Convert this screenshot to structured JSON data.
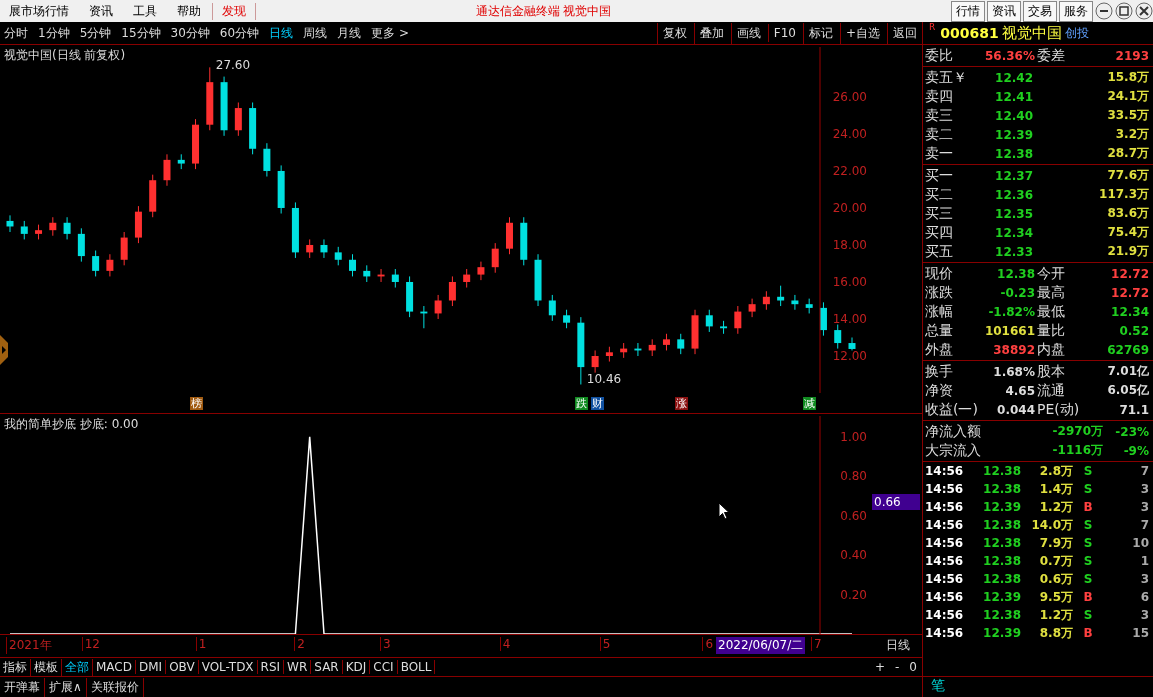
{
  "menu": {
    "items": [
      {
        "label": "展市场行情",
        "selected": false
      },
      {
        "label": "资讯",
        "selected": false
      },
      {
        "label": "工具",
        "selected": false
      },
      {
        "label": "帮助",
        "selected": false
      },
      {
        "label": "发现",
        "selected": true
      }
    ],
    "title": "通达信金融终端  视觉中国",
    "buttons": [
      "行情",
      "资讯",
      "交易",
      "服务"
    ]
  },
  "periods": [
    {
      "label": "分时",
      "selected": false
    },
    {
      "label": "1分钟",
      "selected": false
    },
    {
      "label": "5分钟",
      "selected": false
    },
    {
      "label": "15分钟",
      "selected": false
    },
    {
      "label": "30分钟",
      "selected": false
    },
    {
      "label": "60分钟",
      "selected": false
    },
    {
      "label": "日线",
      "selected": true
    },
    {
      "label": "周线",
      "selected": false
    },
    {
      "label": "月线",
      "selected": false
    },
    {
      "label": "更多 >",
      "selected": false
    }
  ],
  "tools": [
    "复权",
    "叠加",
    "画线",
    "F10",
    "标记",
    "+自选",
    "返回"
  ],
  "chart_title": "视觉中国(日线 前复权)",
  "price_chart": {
    "chart_data": {
      "type": "candlestick",
      "ylim": [
        10,
        28.7
      ],
      "yticks": [
        {
          "value": 12,
          "label": "12.00"
        },
        {
          "value": 14,
          "label": "14.00"
        },
        {
          "value": 16,
          "label": "16.00"
        },
        {
          "value": 18,
          "label": "18.00"
        },
        {
          "value": 20,
          "label": "20.00"
        },
        {
          "value": 22,
          "label": "22.00"
        },
        {
          "value": 24,
          "label": "24.00"
        },
        {
          "value": 26,
          "label": "26.00"
        }
      ],
      "categories": [
        null,
        null,
        null,
        null,
        null,
        null,
        null,
        null,
        null,
        null,
        null,
        null,
        null,
        null,
        null,
        null,
        null,
        null,
        null,
        null,
        null,
        null,
        null,
        null,
        null,
        null,
        null,
        null,
        null,
        null,
        null,
        null,
        null,
        null,
        null,
        null,
        null,
        null,
        null,
        null,
        null,
        null,
        null,
        null,
        null,
        null,
        null,
        null,
        null,
        null,
        null,
        null,
        null,
        null,
        null,
        null,
        null,
        null,
        null,
        null
      ],
      "ohlc": [
        [
          19.3,
          19.6,
          18.7,
          19.0
        ],
        [
          19.0,
          19.3,
          18.3,
          18.6
        ],
        [
          18.6,
          19.1,
          18.3,
          18.8
        ],
        [
          18.8,
          19.5,
          18.5,
          19.2
        ],
        [
          19.2,
          19.5,
          18.3,
          18.6
        ],
        [
          18.6,
          18.9,
          17.1,
          17.4
        ],
        [
          17.4,
          17.7,
          16.3,
          16.6
        ],
        [
          16.6,
          17.5,
          16.3,
          17.2
        ],
        [
          17.2,
          18.7,
          16.9,
          18.4
        ],
        [
          18.4,
          20.1,
          18.1,
          19.8
        ],
        [
          19.8,
          21.8,
          19.5,
          21.5
        ],
        [
          21.5,
          22.9,
          21.2,
          22.6
        ],
        [
          22.6,
          22.9,
          22.1,
          22.4
        ],
        [
          22.4,
          24.8,
          22.1,
          24.5
        ],
        [
          24.5,
          27.6,
          24.2,
          26.8
        ],
        [
          26.8,
          27.1,
          23.9,
          24.2
        ],
        [
          24.2,
          25.7,
          23.9,
          25.4
        ],
        [
          25.4,
          25.7,
          22.9,
          23.2
        ],
        [
          23.2,
          23.5,
          21.7,
          22.0
        ],
        [
          22.0,
          22.3,
          19.7,
          20.0
        ],
        [
          20.0,
          20.3,
          17.3,
          17.6
        ],
        [
          17.6,
          18.3,
          17.3,
          18.0
        ],
        [
          18.0,
          18.3,
          17.3,
          17.6
        ],
        [
          17.6,
          17.9,
          16.9,
          17.2
        ],
        [
          17.2,
          17.5,
          16.3,
          16.6
        ],
        [
          16.6,
          16.9,
          16.0,
          16.3
        ],
        [
          16.3,
          16.7,
          16.0,
          16.4
        ],
        [
          16.4,
          16.7,
          15.7,
          16.0
        ],
        [
          16.0,
          16.3,
          14.1,
          14.4
        ],
        [
          14.4,
          14.7,
          13.5,
          14.3
        ],
        [
          14.3,
          15.3,
          14.0,
          15.0
        ],
        [
          15.0,
          16.3,
          14.7,
          16.0
        ],
        [
          16.0,
          16.7,
          15.7,
          16.4
        ],
        [
          16.4,
          17.1,
          16.1,
          16.8
        ],
        [
          16.8,
          18.1,
          16.5,
          17.8
        ],
        [
          17.8,
          19.5,
          17.5,
          19.2
        ],
        [
          19.2,
          19.5,
          16.9,
          17.2
        ],
        [
          17.2,
          17.5,
          14.7,
          15.0
        ],
        [
          15.0,
          15.3,
          13.9,
          14.2
        ],
        [
          14.2,
          14.5,
          13.5,
          13.8
        ],
        [
          13.8,
          14.1,
          10.46,
          11.4
        ],
        [
          11.4,
          12.3,
          11.1,
          12.0
        ],
        [
          12.0,
          12.5,
          11.7,
          12.2
        ],
        [
          12.2,
          12.7,
          11.9,
          12.4
        ],
        [
          12.4,
          12.7,
          12.0,
          12.3
        ],
        [
          12.3,
          12.9,
          12.0,
          12.6
        ],
        [
          12.6,
          13.2,
          12.3,
          12.9
        ],
        [
          12.9,
          13.2,
          12.1,
          12.4
        ],
        [
          12.4,
          14.5,
          12.1,
          14.2
        ],
        [
          14.2,
          14.5,
          13.3,
          13.6
        ],
        [
          13.6,
          13.9,
          13.2,
          13.5
        ],
        [
          13.5,
          14.7,
          13.2,
          14.4
        ],
        [
          14.4,
          15.1,
          14.1,
          14.8
        ],
        [
          14.8,
          15.5,
          14.5,
          15.2
        ],
        [
          15.2,
          15.8,
          14.7,
          15.0
        ],
        [
          15.0,
          15.3,
          14.5,
          14.8
        ],
        [
          14.8,
          15.1,
          14.3,
          14.6
        ],
        [
          14.6,
          14.9,
          13.1,
          13.4
        ],
        [
          13.4,
          13.7,
          12.4,
          12.7
        ],
        [
          12.7,
          13.0,
          12.3,
          12.38
        ]
      ],
      "annotations": [
        "27.60",
        "10.46"
      ]
    },
    "markers": [
      {
        "label": "榜",
        "color": "#a05a10"
      },
      {
        "label": "跌",
        "color": "#108a20"
      },
      {
        "label": "财",
        "color": "#1050a0"
      },
      {
        "label": "涨",
        "color": "#8a1010"
      },
      {
        "label": "减",
        "color": "#108a20"
      }
    ]
  },
  "indicator": {
    "title": "我的简单抄底 抄底: 0.00",
    "cursor_value": "0.66",
    "chart_data": {
      "type": "line",
      "ylim": [
        0,
        1.106
      ],
      "yticks": [
        {
          "value": 0.2,
          "label": "0.20"
        },
        {
          "value": 0.4,
          "label": "0.40"
        },
        {
          "value": 0.6,
          "label": "0.60"
        },
        {
          "value": 0.8,
          "label": "0.80"
        },
        {
          "value": 1.0,
          "label": "1.00"
        }
      ],
      "categories": [
        null,
        null,
        null,
        null,
        null,
        null,
        null,
        null,
        null,
        null,
        null,
        null,
        null,
        null,
        null,
        null,
        null,
        null,
        null,
        null,
        null,
        null,
        null,
        null,
        null,
        null,
        null,
        null,
        null,
        null,
        null,
        null,
        null,
        null,
        null,
        null,
        null,
        null,
        null,
        null,
        null,
        null,
        null,
        null,
        null,
        null,
        null,
        null,
        null,
        null,
        null,
        null,
        null,
        null,
        null,
        null,
        null,
        null,
        null,
        null
      ],
      "values": [
        0,
        0,
        0,
        0,
        0,
        0,
        0,
        0,
        0,
        0,
        0,
        0,
        0,
        0,
        0,
        0,
        0,
        0,
        0,
        0,
        0,
        1,
        0,
        0,
        0,
        0,
        0,
        0,
        0,
        0,
        0,
        0,
        0,
        0,
        0,
        0,
        0,
        0,
        0,
        0,
        0,
        0,
        0,
        0,
        0,
        0,
        0,
        0,
        0,
        0,
        0,
        0,
        0,
        0,
        0,
        0,
        0,
        0,
        0,
        0
      ]
    }
  },
  "date_labels": [
    "2021年",
    "12",
    "1",
    "2",
    "3",
    "4",
    "5",
    "6",
    "7"
  ],
  "date_cursor": "2022/06/07/二",
  "period_label": "日线",
  "indicator_tabs": [
    {
      "label": "指标",
      "selected": false
    },
    {
      "label": "模板",
      "selected": false
    },
    {
      "label": "全部",
      "selected": true
    },
    {
      "label": "MACD",
      "selected": false
    },
    {
      "label": "DMI",
      "selected": false
    },
    {
      "label": "OBV",
      "selected": false
    },
    {
      "label": "VOL-TDX",
      "selected": false
    },
    {
      "label": "RSI",
      "selected": false
    },
    {
      "label": "WR",
      "selected": false
    },
    {
      "label": "SAR",
      "selected": false
    },
    {
      "label": "KDJ",
      "selected": false
    },
    {
      "label": "CCI",
      "selected": false
    },
    {
      "label": "BOLL",
      "selected": false
    }
  ],
  "zoom_buttons": [
    "+",
    "-",
    "0"
  ],
  "bottom_buttons": [
    "开弹幕",
    "扩展∧",
    "关联报价"
  ],
  "quote": {
    "mark": "R",
    "code": "000681",
    "name": "视觉中国",
    "tag": "创投",
    "ratio": {
      "label": "委比",
      "value": "56.36%",
      "label2": "委差",
      "value2": "2193"
    },
    "asks": [
      {
        "label": "卖五￥",
        "price": "12.42",
        "volume": "15.8万"
      },
      {
        "label": "卖四",
        "price": "12.41",
        "volume": "24.1万"
      },
      {
        "label": "卖三",
        "price": "12.40",
        "volume": "33.5万"
      },
      {
        "label": "卖二",
        "price": "12.39",
        "volume": "3.2万"
      },
      {
        "label": "卖一",
        "price": "12.38",
        "volume": "28.7万"
      }
    ],
    "bids": [
      {
        "label": "买一",
        "price": "12.37",
        "volume": "77.6万"
      },
      {
        "label": "买二",
        "price": "12.36",
        "volume": "117.3万"
      },
      {
        "label": "买三",
        "price": "12.35",
        "volume": "83.6万"
      },
      {
        "label": "买四",
        "price": "12.34",
        "volume": "75.4万"
      },
      {
        "label": "买五",
        "price": "12.33",
        "volume": "21.9万"
      }
    ],
    "stats": [
      [
        {
          "label": "现价",
          "value": "12.38",
          "color": "#20d020"
        },
        {
          "label": "今开",
          "value": "12.72",
          "color": "#ff4040"
        }
      ],
      [
        {
          "label": "涨跌",
          "value": "-0.23",
          "color": "#20d020"
        },
        {
          "label": "最高",
          "value": "12.72",
          "color": "#ff4040"
        }
      ],
      [
        {
          "label": "涨幅",
          "value": "-1.82%",
          "color": "#20d020"
        },
        {
          "label": "最低",
          "value": "12.34",
          "color": "#20d020"
        }
      ],
      [
        {
          "label": "总量",
          "value": "101661",
          "color": "#e0e040"
        },
        {
          "label": "量比",
          "value": "0.52",
          "color": "#20d020"
        }
      ],
      [
        {
          "label": "外盘",
          "value": "38892",
          "color": "#ff4040"
        },
        {
          "label": "内盘",
          "value": "62769",
          "color": "#20d020"
        }
      ]
    ],
    "fundamentals": [
      [
        {
          "label": "换手",
          "value": "1.68%"
        },
        {
          "label": "股本",
          "value": "7.01亿"
        }
      ],
      [
        {
          "label": "净资",
          "value": "4.65"
        },
        {
          "label": "流通",
          "value": "6.05亿"
        }
      ],
      [
        {
          "label": "收益(一)",
          "value": "0.044"
        },
        {
          "label": "PE(动)",
          "value": "71.1"
        }
      ]
    ],
    "flows": [
      {
        "label": "净流入额",
        "amount": "-2970万",
        "percent": "-23%"
      },
      {
        "label": "大宗流入",
        "amount": "-1116万",
        "percent": "-9%"
      }
    ],
    "trades": [
      {
        "time": "14:56",
        "price": "12.38",
        "volume": "2.8万",
        "side": "S",
        "color": "#20d020",
        "count": "7"
      },
      {
        "time": "14:56",
        "price": "12.38",
        "volume": "1.4万",
        "side": "S",
        "color": "#20d020",
        "count": "3"
      },
      {
        "time": "14:56",
        "price": "12.39",
        "volume": "1.2万",
        "side": "B",
        "color": "#ff4040",
        "count": "3"
      },
      {
        "time": "14:56",
        "price": "12.38",
        "volume": "14.0万",
        "side": "S",
        "color": "#20d020",
        "count": "7"
      },
      {
        "time": "14:56",
        "price": "12.38",
        "volume": "7.9万",
        "side": "S",
        "color": "#20d020",
        "count": "10"
      },
      {
        "time": "14:56",
        "price": "12.38",
        "volume": "0.7万",
        "side": "S",
        "color": "#20d020",
        "count": "1"
      },
      {
        "time": "14:56",
        "price": "12.38",
        "volume": "0.6万",
        "side": "S",
        "color": "#20d020",
        "count": "3"
      },
      {
        "time": "14:56",
        "price": "12.39",
        "volume": "9.5万",
        "side": "B",
        "color": "#ff4040",
        "count": "6"
      },
      {
        "time": "14:56",
        "price": "12.38",
        "volume": "1.2万",
        "side": "S",
        "color": "#20d020",
        "count": "3"
      },
      {
        "time": "14:56",
        "price": "12.39",
        "volume": "8.8万",
        "side": "B",
        "color": "#ff4040",
        "count": "15"
      }
    ],
    "tab": "笔"
  }
}
